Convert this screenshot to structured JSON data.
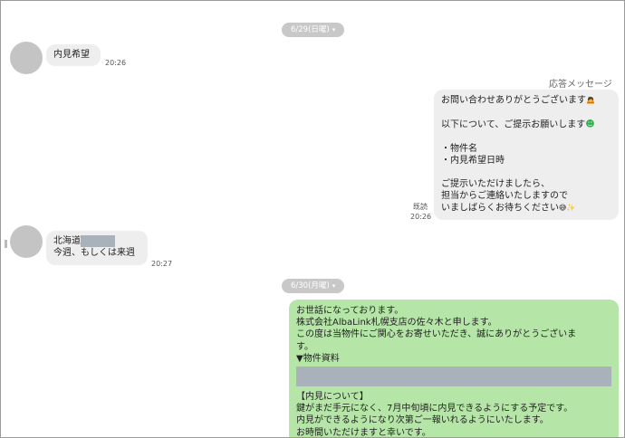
{
  "dates": {
    "first": "6/29(日曜)",
    "second": "6/30(月曜)",
    "chevron": "▾"
  },
  "messages": {
    "m1": {
      "text": "内見希望",
      "time": "20:26"
    },
    "m2": {
      "header": "応答メッセージ",
      "lines": [
        "お問い合わせありがとうございます",
        "以下について、ご提示お願いします",
        "・物件名",
        "・内見希望日時",
        "ご提示いただけましたら、",
        "担当からご連絡いたしますので",
        "いましばらくお待ちください"
      ],
      "read": "既読",
      "time": "20:26"
    },
    "m3": {
      "line1": "北海道",
      "line2": "今週、もしくは来週",
      "time": "20:27"
    },
    "m4": {
      "lines": [
        "お世話になっております。",
        "株式会社AlbaLink札幌支店の佐々木と申します。",
        "この度は当物件にご関心をお寄せいただき、誠にありがとうございま",
        "す。",
        "▼物件資料",
        "【内見について】",
        "鍵がまだ手元になく、7月中旬頃に内見できるようにする予定です。",
        "内見ができるようになり次第ご一報いれるようにいたします。",
        "お時間いただけますと幸いです。"
      ]
    }
  },
  "icons": {
    "face": "🙇",
    "smile": "☻",
    "sweat": "😅",
    "sparkle": "✨"
  },
  "colors": {
    "green_bubble": "#b5e6a7",
    "gray_bubble": "#eeeeee",
    "pill": "#c8c8c8",
    "redaction": "#a9b2ba"
  }
}
